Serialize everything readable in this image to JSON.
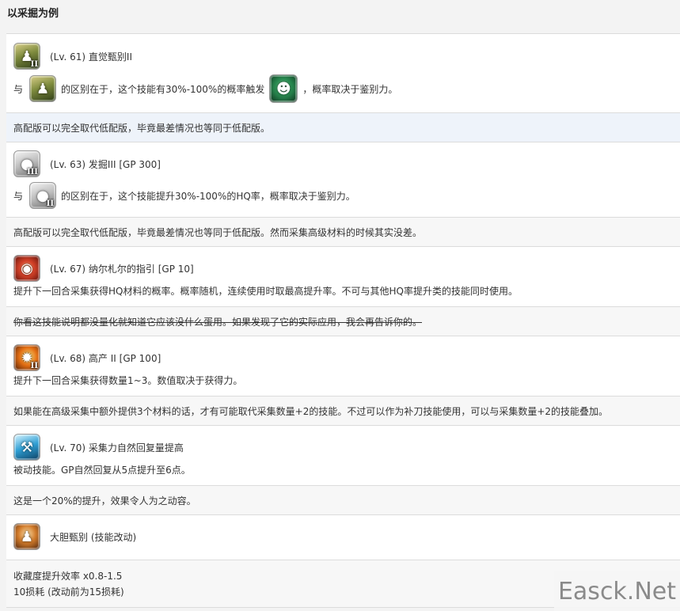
{
  "page_title": "以采掘为例",
  "sections": [
    {
      "title": "(Lv. 61) 直觉甄别II",
      "desc_prefix": "与",
      "desc_mid": "的区别在于，这个技能有30%-100%的概率触发",
      "desc_suffix": "，概率取决于鉴别力。",
      "note": "高配版可以完全取代低配版，毕竟最差情况也等同于低配版。"
    },
    {
      "title": "(Lv. 63) 发掘III [GP 300]",
      "desc_prefix": "与",
      "desc_mid": "的区别在于，这个技能提升30%-100%的HQ率，概率取决于鉴别力。",
      "note": "高配版可以完全取代低配版，毕竟最差情况也等同于低配版。然而采集高级材料的时候其实没差。"
    },
    {
      "title": "(Lv. 67) 纳尔札尔的指引 [GP 10]",
      "desc": "提升下一回合采集获得HQ材料的概率。概率随机，连续使用时取最高提升率。不可与其他HQ率提升类的技能同时使用。",
      "note": "你看这技能说明都没量化就知道它应该没什么蛋用。如果发现了它的实际应用，我会再告诉你的。"
    },
    {
      "title": "(Lv. 68) 高产 II [GP 100]",
      "desc": "提升下一回合采集获得数量1~3。数值取决于获得力。",
      "note": "如果能在高级采集中额外提供3个材料的话，才有可能取代采集数量+2的技能。不过可以作为补刀技能使用，可以与采集数量+2的技能叠加。"
    },
    {
      "title": "(Lv. 70) 采集力自然回复量提高",
      "desc": "被动技能。GP自然回复从5点提升至6点。",
      "note": "这是一个20%的提升，效果令人为之动容。"
    },
    {
      "title": "大胆甄别 (技能改动)",
      "desc_line1": "收藏度提升效率 x0.8-1.5",
      "desc_line2": "10损耗 (改动前为15损耗)"
    }
  ],
  "icon_badges": {
    "two": "II",
    "three": "III"
  },
  "watermark": "Easck.Net"
}
